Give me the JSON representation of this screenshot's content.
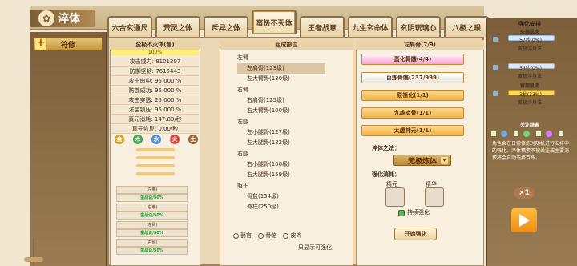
{
  "header": {
    "title": "淬体",
    "tabs": [
      "六合玄通尺",
      "荒灵之体",
      "斥异之体",
      "蛮极不灭体",
      "王者战意",
      "九生玄命体",
      "玄阴玩璃心",
      "八极之眼"
    ],
    "left_button": "符修"
  },
  "left_panel": {
    "title": "蛮极不灭体(静)",
    "progress": "100%",
    "stats": [
      "攻击威力: 8101297",
      "防御坚韧: 7615443",
      "攻击命中: 95.000 %",
      "防御成功: 95.000 %",
      "攻击穿透: 25.000 %",
      "法宝镇压: 95.000 %",
      "真元消耗: 147.80/秒",
      "真元恢复: 0.00/秒"
    ],
    "elements": [
      "金",
      "木",
      "水",
      "火",
      "土"
    ],
    "rows": [
      {
        "label": "(左拳)",
        "value": "蛮战诀/50%"
      },
      {
        "label": "(右拳)",
        "value": "蛮战诀/50%"
      },
      {
        "label": "(左臂)",
        "value": "蛮战诀/50%"
      },
      {
        "label": "(右臂)",
        "value": "蛮战诀/50%"
      }
    ]
  },
  "center_panel": {
    "title": "组成部位",
    "tree": [
      {
        "label": "左臂",
        "children": [
          "左肩骨(123级)",
          "左大臂骨(130级)"
        ]
      },
      {
        "label": "右臂",
        "children": [
          "右肩骨(125级)",
          "右大臂骨(100级)"
        ]
      },
      {
        "label": "左腿",
        "children": [
          "左小腿骨(127级)",
          "左大腿骨(132级)"
        ]
      },
      {
        "label": "右腿",
        "children": [
          "右小腿骨(100级)",
          "右大腿骨(159级)"
        ]
      },
      {
        "label": "躯干",
        "children": [
          "骨盆(154级)",
          "脊柱(250级)"
        ]
      }
    ],
    "filters": [
      "器官",
      "骨骼",
      "皮肉"
    ],
    "footer_toggle": "只显示可强化"
  },
  "right_panel": {
    "title": "左肩骨(7/9)",
    "skills": [
      "蛮化骨髓(4/4)",
      "百炼骨骼(237/999)",
      "原祖化(1/1)",
      "九雄炎骨(1/1)",
      "太虚神元(1/1)"
    ],
    "method_label": "淬体之法：",
    "method_value": "无极炼体",
    "consume_label": "强化消耗：",
    "consume_items": [
      "精元",
      "精华"
    ],
    "continuous_label": "持续强化",
    "start_button": "开始强化"
  },
  "right_side": {
    "title": "强化安排",
    "entries": [
      {
        "name": "头部肌肉",
        "value": "57秒(0%)",
        "desc": "蛮极淬身法"
      },
      {
        "name": "",
        "value": "54秒(0%)",
        "desc": "蛮极淬身法"
      },
      {
        "name": "背部肌肉",
        "value": "3秒(33%)",
        "desc": "蛮极淬身法"
      }
    ],
    "focus_title": "关注精素",
    "description": "角色会在日常修炼时随机进行安排中的强化。淬体精素不被关注或主要消费将会自动选择百炼。",
    "multiplier": "×1"
  },
  "colors": {
    "accent": "#c58f3e",
    "panel": "#f8efde",
    "brown": "#7c5f3a",
    "gold": "#f0b34a"
  }
}
